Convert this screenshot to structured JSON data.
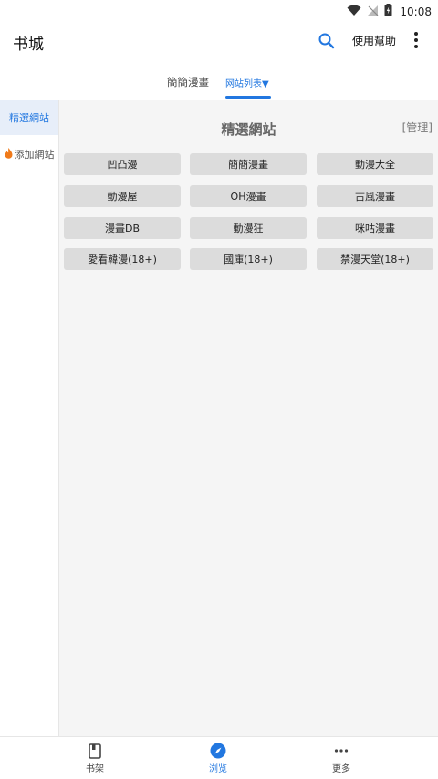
{
  "status": {
    "time": "10:08",
    "icons": [
      "wifi-icon",
      "signal-off-icon",
      "battery-charging-icon"
    ]
  },
  "appbar": {
    "title": "书城",
    "help_label": "使用幫助",
    "search_icon": "search-icon",
    "more_icon": "more-vertical-icon"
  },
  "tabs": [
    {
      "label": "簡簡漫畫"
    },
    {
      "label": "网站列表▼"
    }
  ],
  "colors": {
    "accent": "#2277e0",
    "button_bg": "#dcdcdc",
    "content_bg": "#f5f5f5"
  },
  "sidebar": {
    "items": [
      {
        "label": "精選網站"
      },
      {
        "label": "添加網站",
        "icon": "fire-icon"
      }
    ]
  },
  "main": {
    "section_title": "精選網站",
    "manage_label": "[管理]",
    "sites": [
      "凹凸漫",
      "簡簡漫畫",
      "動漫大全",
      "動漫屋",
      "OH漫畫",
      "古風漫畫",
      "漫畫DB",
      "動漫狂",
      "咪咕漫畫",
      "愛看韓漫(18+)",
      "國庫(18+)",
      "禁漫天堂(18+)"
    ]
  },
  "bottom_nav": [
    {
      "label": "书架",
      "icon": "book-icon"
    },
    {
      "label": "浏览",
      "icon": "compass-icon"
    },
    {
      "label": "更多",
      "icon": "more-horizontal-icon"
    }
  ]
}
